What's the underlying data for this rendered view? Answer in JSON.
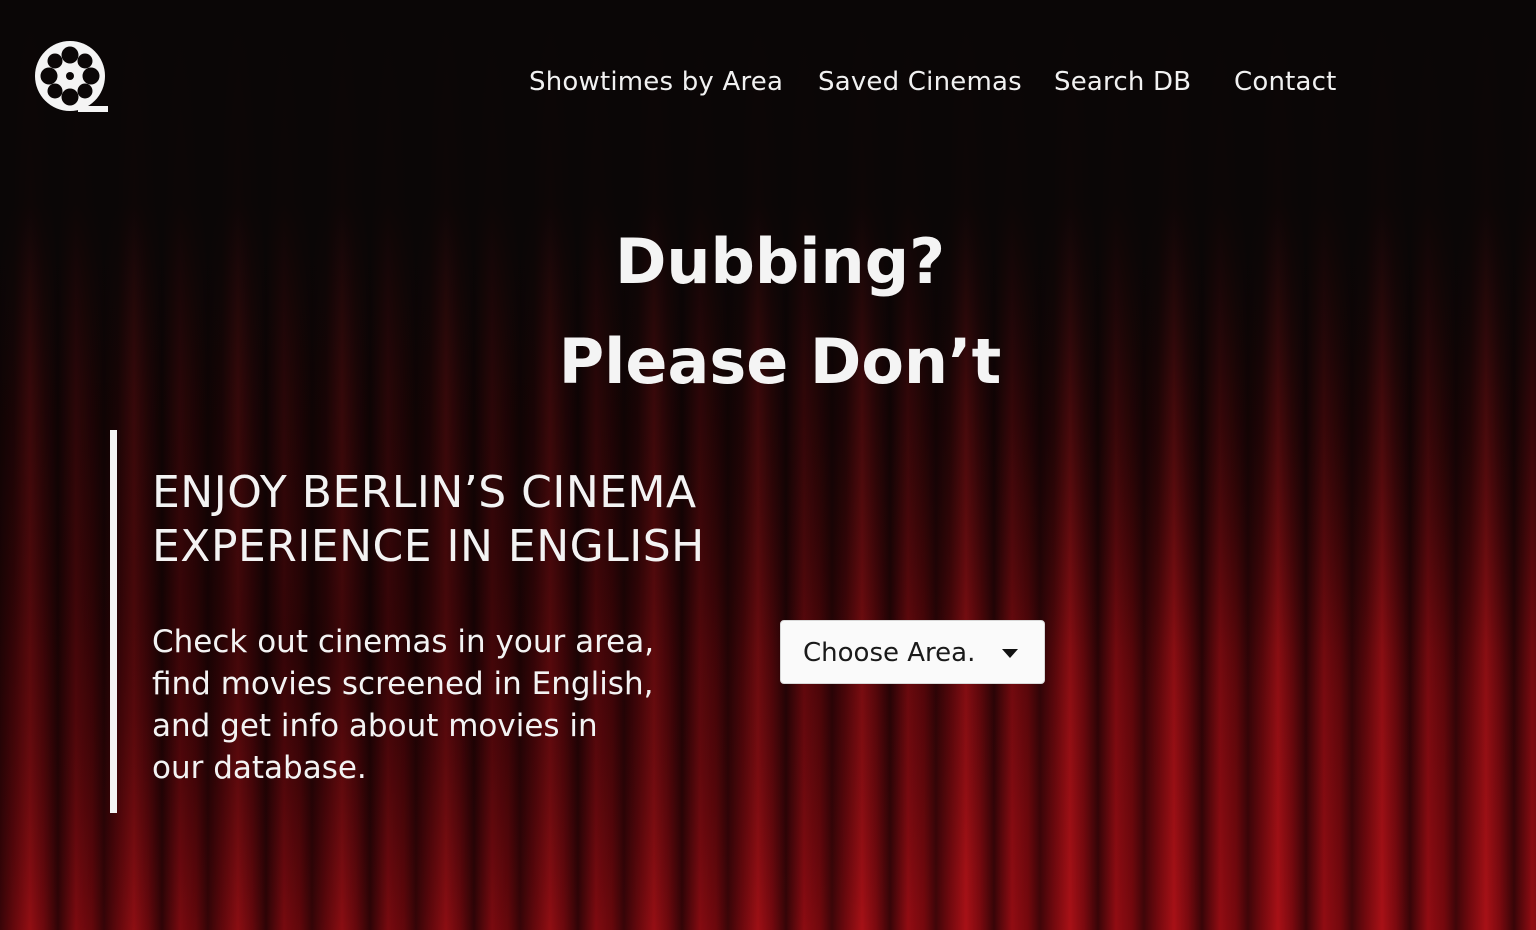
{
  "header": {
    "logo_icon": "film-reel-icon",
    "nav": [
      {
        "label": "Showtimes by Area"
      },
      {
        "label": "Saved Cinemas"
      },
      {
        "label": "Search DB"
      },
      {
        "label": "Contact"
      }
    ]
  },
  "hero": {
    "line1": "Dubbing?",
    "line2": "Please Don’t"
  },
  "intro": {
    "tagline_line1": "ENJOY BERLIN’S CINEMA",
    "tagline_line2": "EXPERIENCE IN ENGLISH",
    "blurb_lines": [
      "Check out cinemas in your area,",
      "find movies screened in English,",
      "and get info about movies in",
      "our database."
    ]
  },
  "area_select": {
    "selected_label": "Choose Area.",
    "icon": "caret-down-icon"
  },
  "colors": {
    "background": "#0b0707",
    "curtain_red": "#8e0c13",
    "text": "#f4f4f4",
    "select_bg": "#fafafa"
  }
}
